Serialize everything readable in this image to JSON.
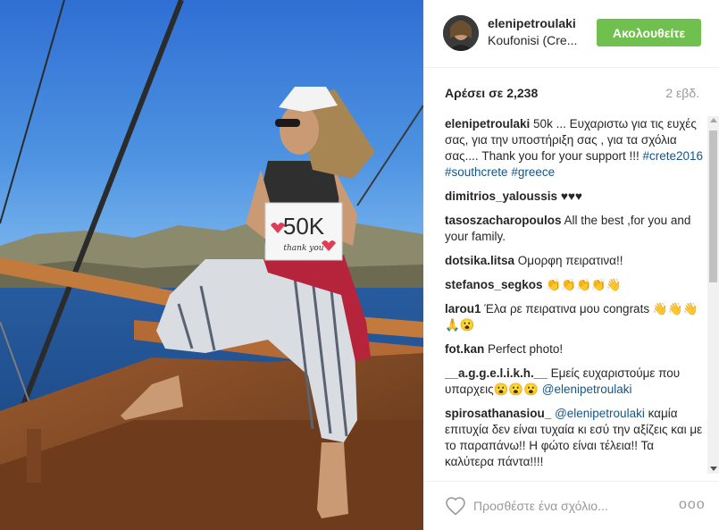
{
  "post": {
    "username": "elenipetroulaki",
    "location": "Koufonisi (Cre...",
    "follow_label": "Ακολουθείτε",
    "likes_text": "Αρέσει σε 2,238",
    "age_text": "2 εβδ.",
    "sign_text": "50K",
    "sign_subtext": "thank you"
  },
  "comments": [
    {
      "user": "elenipetroulaki",
      "parts": [
        {
          "t": "text",
          "v": "50k ... Ευχαριστω για τις ευχές σας, για την υποστήριξη σας , για τα σχόλια σας.... Thank you for your support !!! "
        },
        {
          "t": "tag",
          "v": "#crete2016"
        },
        {
          "t": "text",
          "v": " "
        },
        {
          "t": "tag",
          "v": "#southcrete"
        },
        {
          "t": "text",
          "v": " "
        },
        {
          "t": "tag",
          "v": "#greece"
        }
      ]
    },
    {
      "user": "dimitrios_yaloussis",
      "parts": [
        {
          "t": "text",
          "v": "♥♥♥"
        }
      ]
    },
    {
      "user": "tasoszacharopoulos",
      "parts": [
        {
          "t": "text",
          "v": "All the best ,for you and your family."
        }
      ]
    },
    {
      "user": "dotsika.litsa",
      "parts": [
        {
          "t": "text",
          "v": "Ομορφη πειρατινα!!"
        }
      ]
    },
    {
      "user": "stefanos_segkos",
      "parts": [
        {
          "t": "text",
          "v": "👏👏👏👏👋"
        }
      ]
    },
    {
      "user": "larou1",
      "parts": [
        {
          "t": "text",
          "v": "Έλα ρε πειρατινα μου congrats 👋👋👋🙏😮"
        }
      ]
    },
    {
      "user": "fot.kan",
      "parts": [
        {
          "t": "text",
          "v": "Perfect photo!"
        }
      ]
    },
    {
      "user": "__a.g.g.e.l.i.k.h.__",
      "parts": [
        {
          "t": "text",
          "v": "Εμείς ευχαριστούμε που υπαρχεις😮😮😮 "
        },
        {
          "t": "mention",
          "v": "@elenipetroulaki"
        }
      ]
    },
    {
      "user": "spirosathanasiou_",
      "parts": [
        {
          "t": "mention",
          "v": "@elenipetroulaki"
        },
        {
          "t": "text",
          "v": " καμία επιτυχία δεν είναι τυχαία κι εσύ την αξίζεις και με το παραπάνω!! Η φώτο είναι τέλεια!! Τα καλύτερα πάντα!!!!"
        }
      ]
    }
  ],
  "footer": {
    "comment_placeholder": "Προσθέστε ένα σχόλιο...",
    "more_label": "ooo"
  },
  "icons": {
    "like": "heart-outline-icon",
    "more": "more-options-icon"
  },
  "colors": {
    "follow_button": "#70c050",
    "link": "#125688",
    "muted": "#999999"
  }
}
